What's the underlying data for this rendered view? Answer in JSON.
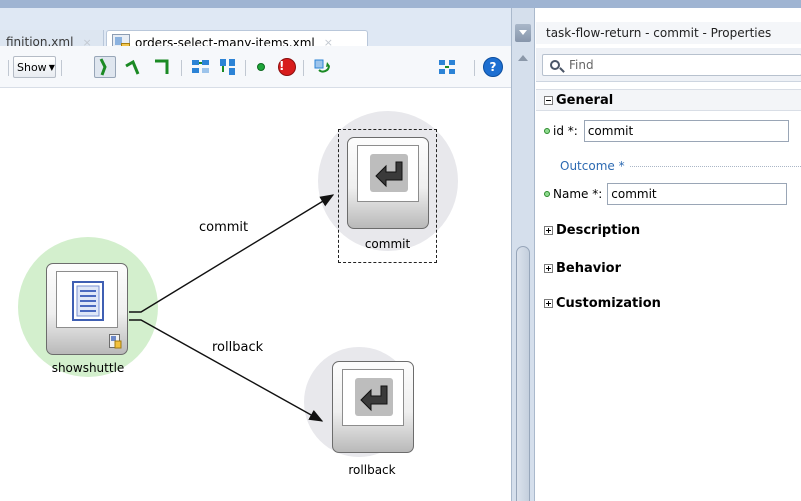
{
  "editor": {
    "tabs": [
      {
        "label": "finition.xml",
        "close": "×"
      },
      {
        "label": "orders-select-many-items.xml",
        "close": "×"
      }
    ],
    "toolbar": {
      "show_label": "Show",
      "help_glyph": "?",
      "error_glyph": "!"
    }
  },
  "diagram": {
    "nodes": [
      {
        "label": "showshuttle",
        "icon": "view-activity-icon"
      },
      {
        "label": "commit",
        "icon": "task-flow-return-icon"
      },
      {
        "label": "rollback",
        "icon": "task-flow-return-icon"
      }
    ],
    "edges": [
      {
        "label": "commit"
      },
      {
        "label": "rollback"
      }
    ]
  },
  "properties": {
    "title": "task-flow-return - commit - Properties",
    "find_placeholder": "Find",
    "sections": {
      "general": "General",
      "description": "Description",
      "behavior": "Behavior",
      "customization": "Customization"
    },
    "fields": {
      "id_label": "id *:",
      "id_value": "commit",
      "outcome_label": "Outcome *",
      "name_label": "Name *:",
      "name_value": "commit"
    }
  },
  "colors": {
    "halo_green": "#d3efcd",
    "halo_gray": "#e8e8ec",
    "accent_blue": "#1d6fd1"
  }
}
